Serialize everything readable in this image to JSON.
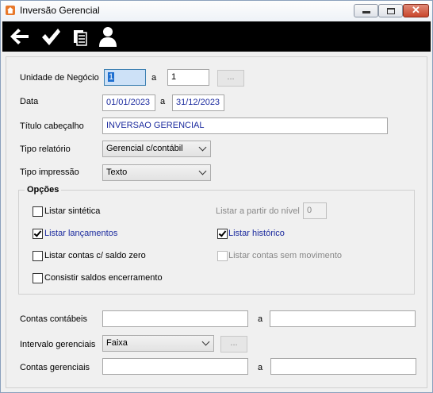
{
  "window": {
    "title": "Inversão Gerencial",
    "close_glyph": "✕"
  },
  "toolbar": {
    "icons": [
      "back-arrow-icon",
      "check-icon",
      "documents-icon",
      "user-icon"
    ]
  },
  "form": {
    "unidade": {
      "label": "Unidade de Negócio",
      "from": "1",
      "sep": "a",
      "to": "1",
      "browse": "..."
    },
    "data": {
      "label": "Data",
      "from": "01/01/2023",
      "sep": "a",
      "to": "31/12/2023"
    },
    "titulo": {
      "label": "Título cabeçalho",
      "value": "INVERSAO GERENCIAL"
    },
    "tipo_relatorio": {
      "label": "Tipo relatório",
      "value": "Gerencial c/contábil"
    },
    "tipo_impressao": {
      "label": "Tipo impressão",
      "value": "Texto"
    },
    "opcoes": {
      "title": "Opções",
      "listar_sintetica": {
        "label": "Listar sintética",
        "checked": false
      },
      "listar_lancamentos": {
        "label": "Listar lançamentos",
        "checked": true
      },
      "listar_contas_saldo_zero": {
        "label": "Listar contas c/ saldo zero",
        "checked": false
      },
      "consistir_saldos": {
        "label": "Consistir saldos encerramento",
        "checked": false
      },
      "listar_nivel": {
        "label": "Listar a partir do nível",
        "value": "0"
      },
      "listar_historico": {
        "label": "Listar histórico",
        "checked": true
      },
      "listar_sem_movimento": {
        "label": "Listar contas sem movimento",
        "checked": false
      }
    },
    "contas_contabeis": {
      "label": "Contas contábeis",
      "from": "",
      "sep": "a",
      "to": ""
    },
    "intervalo_gerenciais": {
      "label": "Intervalo gerenciais",
      "value": "Faixa",
      "browse": "..."
    },
    "contas_gerenciais": {
      "label": "Contas gerenciais",
      "from": "",
      "sep": "a",
      "to": ""
    }
  },
  "colors": {
    "toolbar_bg": "#000000",
    "label_blue": "#1b2a9e",
    "selection": "#1e6fd0"
  }
}
